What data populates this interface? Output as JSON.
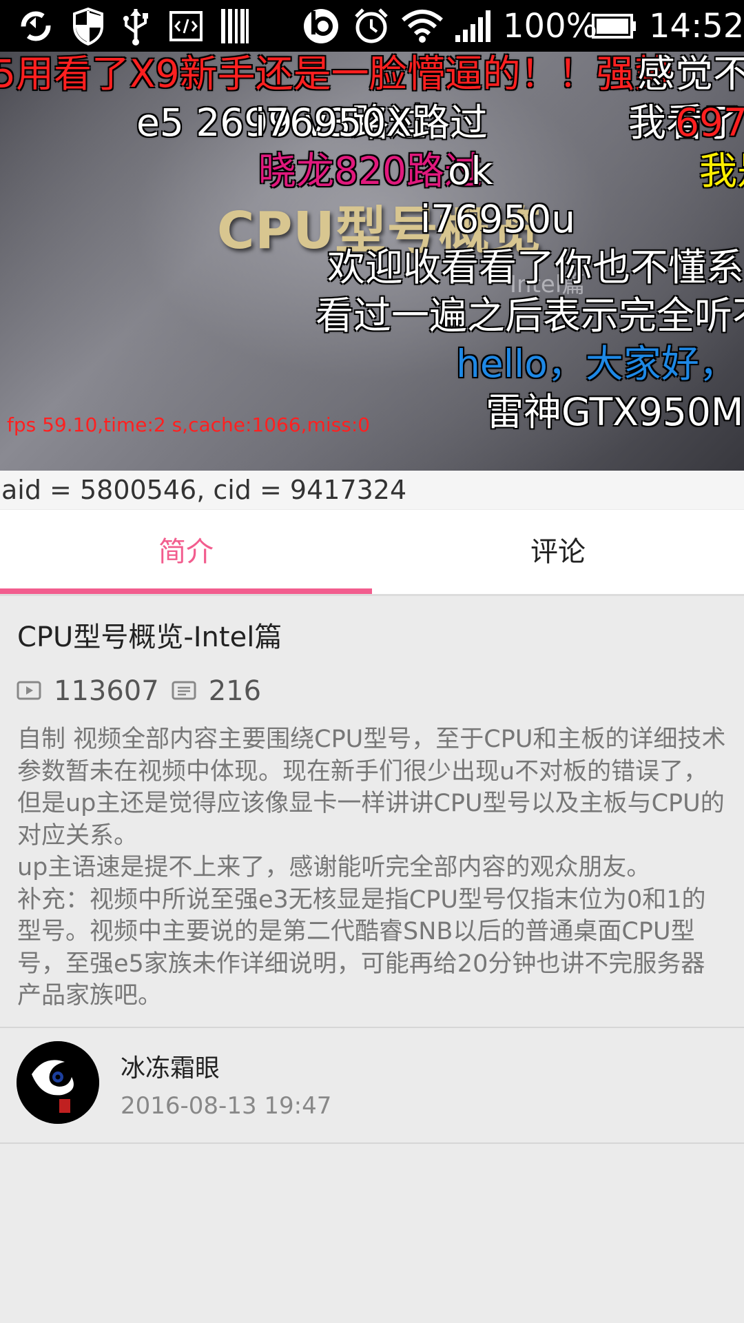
{
  "status_bar": {
    "battery": "100%",
    "time": "14:52",
    "icons": [
      "sync-icon",
      "shield-icon",
      "usb-icon",
      "code-icon",
      "barcode-icon",
      "beats-icon",
      "alarm-icon",
      "wifi-icon",
      "signal-icon",
      "battery-icon"
    ]
  },
  "video": {
    "slide_title": "CPU型号概览",
    "slide_subtitle": "Intel篇",
    "fps_debug": "fps 59.10,time:2 s,cache:1066,miss:0",
    "danmaku": [
      {
        "text": "5用看了X9新手还是一脸懵逼的！！强势",
        "color": "#ff2020"
      },
      {
        "text": "感觉不",
        "color": "#ffffff"
      },
      {
        "text": "e5 2699 v3路过",
        "color": "#ffffff"
      },
      {
        "text": "i76950X路过",
        "color": "#ffffff"
      },
      {
        "text": "我看了",
        "color": "#ffffff"
      },
      {
        "text": "697",
        "color": "#ff2020"
      },
      {
        "text": "晓龙820路过",
        "color": "#e0197d"
      },
      {
        "text": "ok",
        "color": "#ffffff"
      },
      {
        "text": "我是",
        "color": "#ffee00"
      },
      {
        "text": "i76950u",
        "color": "#ffffff"
      },
      {
        "text": "欢迎收看看了你也不懂系",
        "color": "#ffffff"
      },
      {
        "text": "看过一遍之后表示完全听不",
        "color": "#ffffff"
      },
      {
        "text": "hello，大家好，",
        "color": "#1e88e5"
      },
      {
        "text": "雷神GTX950M",
        "color": "#ffffff"
      }
    ]
  },
  "info_line": "aid = 5800546, cid = 9417324",
  "tabs": [
    {
      "label": "简介",
      "active": true
    },
    {
      "label": "评论",
      "active": false
    }
  ],
  "accent_color": "#f25d8e",
  "details": {
    "title": "CPU型号概览-Intel篇",
    "play_count": "113607",
    "danmaku_count": "216",
    "description": "自制 视频全部内容主要围绕CPU型号，至于CPU和主板的详细技术参数暂未在视频中体现。现在新手们很少出现u不对板的错误了，但是up主还是觉得应该像显卡一样讲讲CPU型号以及主板与CPU的对应关系。\nup主语速是提不上来了，感谢能听完全部内容的观众朋友。\n补充：视频中所说至强e3无核显是指CPU型号仅指末位为0和1的型号。视频中主要说的是第二代酷睿SNB以后的普通桌面CPU型号，至强e5家族未作详细说明，可能再给20分钟也讲不完服务器产品家族吧。"
  },
  "uploader": {
    "name": "冰冻霜眼",
    "date": "2016-08-13 19:47"
  }
}
